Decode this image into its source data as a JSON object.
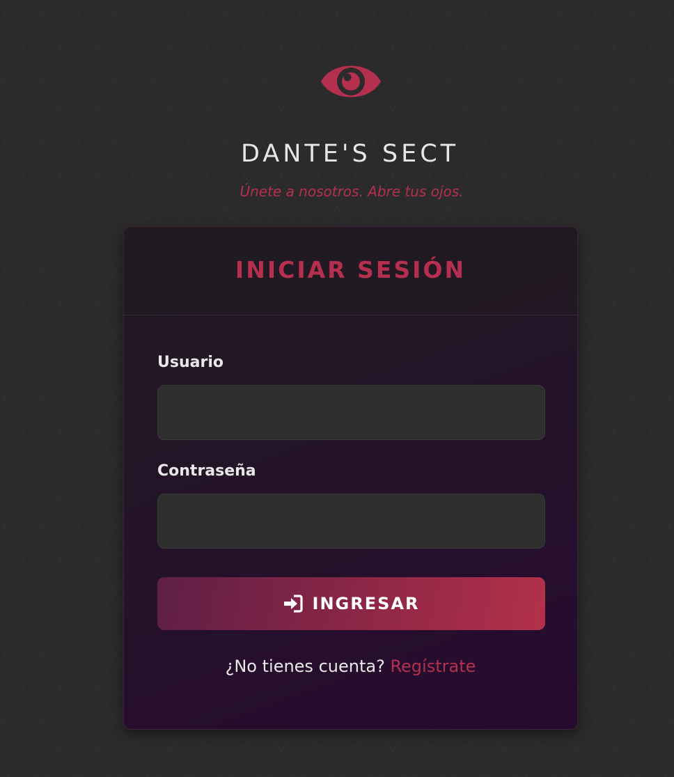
{
  "brand": {
    "logo_icon": "eye-icon",
    "title": "DANTE'S SECT",
    "tagline": "Únete a nosotros. Abre tus ojos."
  },
  "login": {
    "title": "INICIAR SESIÓN",
    "username_label": "Usuario",
    "username_value": "",
    "password_label": "Contraseña",
    "password_value": "",
    "submit_icon": "sign-in-icon",
    "submit_label": "INGRESAR",
    "register_prompt": "¿No tienes cuenta?",
    "register_link": "Regístrate"
  },
  "colors": {
    "accent": "#b5304f",
    "background": "#2b2b2b",
    "card_dark": "#221b23",
    "card_purple": "#270a30",
    "input_bg": "#2e2e2e",
    "text": "#e8e8e8"
  }
}
